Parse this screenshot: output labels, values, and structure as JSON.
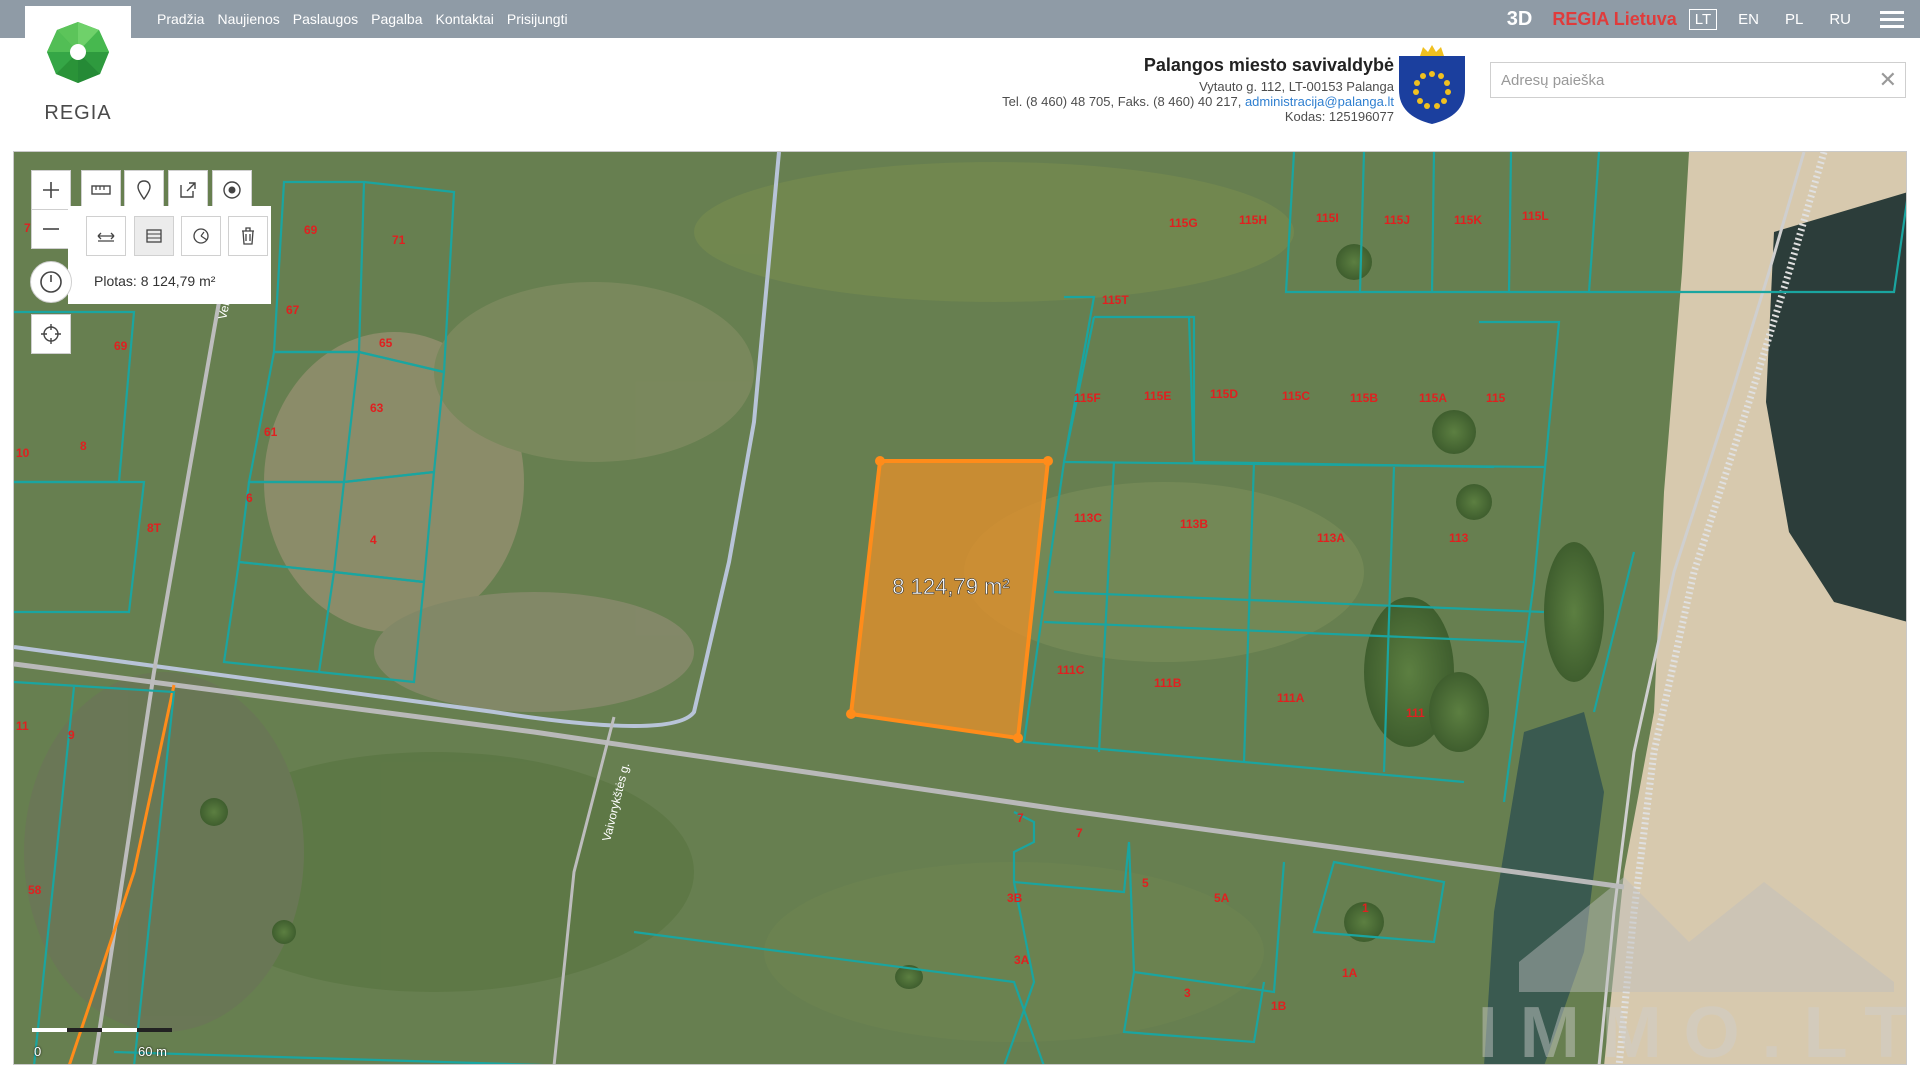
{
  "nav": [
    "Pradžia",
    "Naujienos",
    "Paslaugos",
    "Pagalba",
    "Kontaktai",
    "Prisijungti"
  ],
  "topright": {
    "mode3d": "3D",
    "site": "REGIA Lietuva",
    "langs": [
      "LT",
      "EN",
      "PL",
      "RU"
    ],
    "active_lang": "LT"
  },
  "logo": {
    "text": "REGIA"
  },
  "municipality": {
    "name": "Palangos miesto savivaldybė",
    "address": "Vytauto g. 112, LT-00153 Palanga",
    "phone": "Tel. (8 460) 48 705, Faks. (8 460) 40 217,",
    "email": "administracija@palanga.lt",
    "code": "Kodas: 125196077"
  },
  "search": {
    "placeholder": "Adresų paieška",
    "value": "",
    "clear": "✕"
  },
  "measure": {
    "result": "Plotas: 8 124,79 m²",
    "map_label": "8 124,79 m²"
  },
  "scale": {
    "start": "0",
    "end": "60 m"
  },
  "parcels": [
    "115G",
    "115H",
    "115I",
    "115J",
    "115K",
    "115L",
    "115T",
    "115F",
    "115E",
    "115D",
    "115C",
    "115B",
    "115A",
    "115",
    "113C",
    "113B",
    "113A",
    "113",
    "111C",
    "111B",
    "111A",
    "111",
    "7",
    "7",
    "5",
    "5A",
    "1",
    "3B",
    "3A",
    "3",
    "1B",
    "1A",
    "69",
    "71",
    "67",
    "65",
    "63",
    "61",
    "6",
    "4",
    "69",
    "8",
    "10",
    "8T",
    "7",
    "11",
    "9",
    "58"
  ],
  "streets": [
    "Ver",
    "Vaivorykštės g."
  ],
  "watermark": "IMMO.LT",
  "colors": {
    "parcel_line": "#1aa5a0",
    "selection_fill": "#e8902a",
    "selection_stroke": "#ff8c1a",
    "topbar": "#8f9ba6",
    "link": "#2f7fd0",
    "alert": "#e03b3b"
  }
}
